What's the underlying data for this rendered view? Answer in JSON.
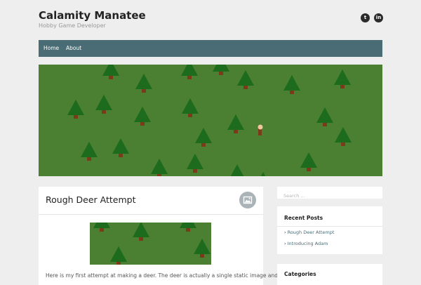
{
  "site": {
    "title": "Calamity Manatee",
    "tagline": "Hobby Game Developer"
  },
  "social": [
    {
      "name": "twitter",
      "glyph": "t"
    },
    {
      "name": "linkedin",
      "glyph": "in"
    }
  ],
  "nav": {
    "items": [
      {
        "label": "Home"
      },
      {
        "label": "About"
      }
    ]
  },
  "colors": {
    "nav_bg": "#4a6c75",
    "grass": "#4b7f31",
    "tree": "#1d6b1d",
    "trunk": "#7a3b1a",
    "deer": "#f0c8a0"
  },
  "post": {
    "title": "Rough Deer Attempt",
    "format_icon": "image-icon",
    "excerpt": "Here is my first attempt at making a deer. The deer is actually a single static image and"
  },
  "search": {
    "placeholder": "Search …"
  },
  "sidebar": {
    "recent_title": "Recent Posts",
    "recent_posts": [
      {
        "label": "Rough Deer Attempt"
      },
      {
        "label": "Introducing Adam"
      }
    ],
    "categories_title": "Categories"
  }
}
